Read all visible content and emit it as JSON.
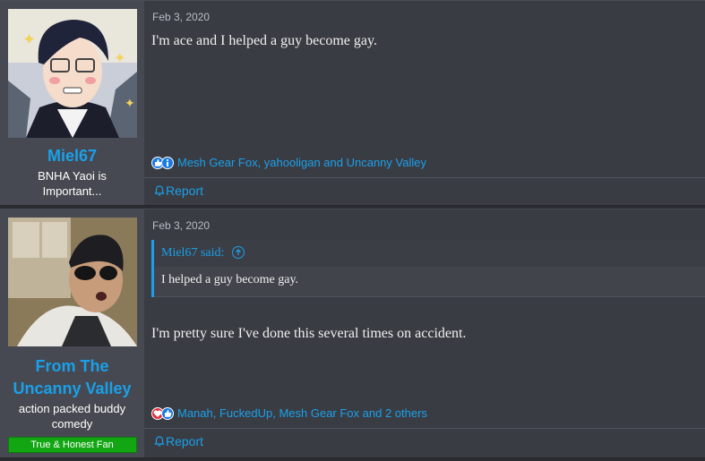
{
  "posts": [
    {
      "date": "Feb 3, 2020",
      "author": "Miel67",
      "user_title": "BNHA Yaoi is Important...",
      "avatar_icon": "anime-character-glasses-avatar",
      "message": "I'm ace and I helped a guy become gay.",
      "reactions": {
        "icons": [
          "like-icon",
          "info-icon"
        ],
        "text": "Mesh Gear Fox, yahooligan and Uncanny Valley"
      },
      "report_label": "Report"
    },
    {
      "date": "Feb 3, 2020",
      "author": "From The Uncanny Valley",
      "user_title": "action packed buddy comedy",
      "banner": "True & Honest Fan",
      "avatar_icon": "anime-character-sunglasses-avatar",
      "quote": {
        "author_line": "Miel67 said:",
        "text": "I helped a guy become gay."
      },
      "message": "I'm pretty sure I've done this several times on accident.",
      "reactions": {
        "icons": [
          "heart-icon",
          "like-icon"
        ],
        "text": "Manah, FuckedUp, Mesh Gear Fox and 2 others"
      },
      "report_label": "Report"
    }
  ],
  "colors": {
    "accent": "#1aa0ea",
    "background": "#2a2c31",
    "post_bg": "#3a3c43",
    "user_bg": "#464951",
    "banner_green": "#12a712"
  }
}
